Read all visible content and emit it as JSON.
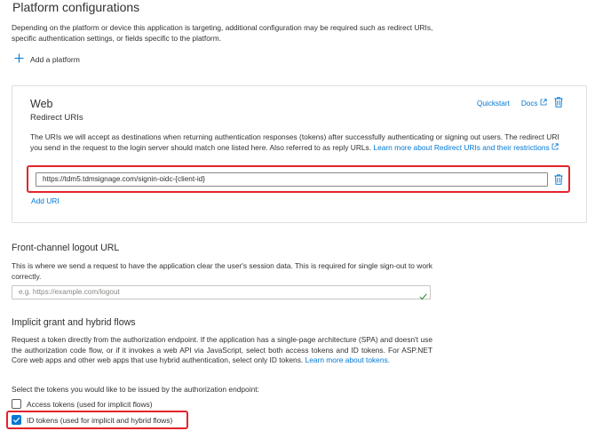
{
  "header": {
    "title": "Platform configurations"
  },
  "intro": {
    "text": "Depending on the platform or device this application is targeting, additional configuration may be required such as redirect URIs, specific authentication settings, or fields specific to the platform."
  },
  "add_platform": {
    "label": "Add a platform",
    "icon": "plus-icon"
  },
  "web_card": {
    "title": "Web",
    "subtitle": "Redirect URIs",
    "quickstart_label": "Quickstart",
    "docs_label": "Docs",
    "description": "The URIs we will accept as destinations when returning authentication responses (tokens) after successfully authenticating or signing out users. The redirect URI you send in the request to the login server should match one listed here. Also referred to as reply URLs.",
    "learn_more_label": "Learn more about Redirect URIs and their restrictions",
    "redirect_uri_value": "https://tdm5.tdmsignage.com/signin-oidc-{client-id}",
    "add_uri_label": "Add URI",
    "highlight_color": "#e3242b"
  },
  "logout": {
    "title": "Front-channel logout URL",
    "description": "This is where we send a request to have the application clear the user's session data. This is required for single sign-out to work correctly.",
    "placeholder": "e.g. https://example.com/logout"
  },
  "implicit": {
    "title": "Implicit grant and hybrid flows",
    "description": "Request a token directly from the authorization endpoint. If the application has a single-page architecture (SPA) and doesn't use the authorization code flow, or if it invokes a web API via JavaScript, select both access tokens and ID tokens. For ASP.NET Core web apps and other web apps that use hybrid authentication, select only ID tokens.",
    "learn_more_label": "Learn more about tokens.",
    "select_prompt": "Select the tokens you would like to be issued by the authorization endpoint:",
    "access_tokens": {
      "label": "Access tokens (used for implicit flows)",
      "checked": false
    },
    "id_tokens": {
      "label": "ID tokens (used for implicit and hybrid flows)",
      "checked": true
    }
  },
  "colors": {
    "accent": "#0078d4",
    "highlight": "#e3242b",
    "valid": "#107c10"
  }
}
